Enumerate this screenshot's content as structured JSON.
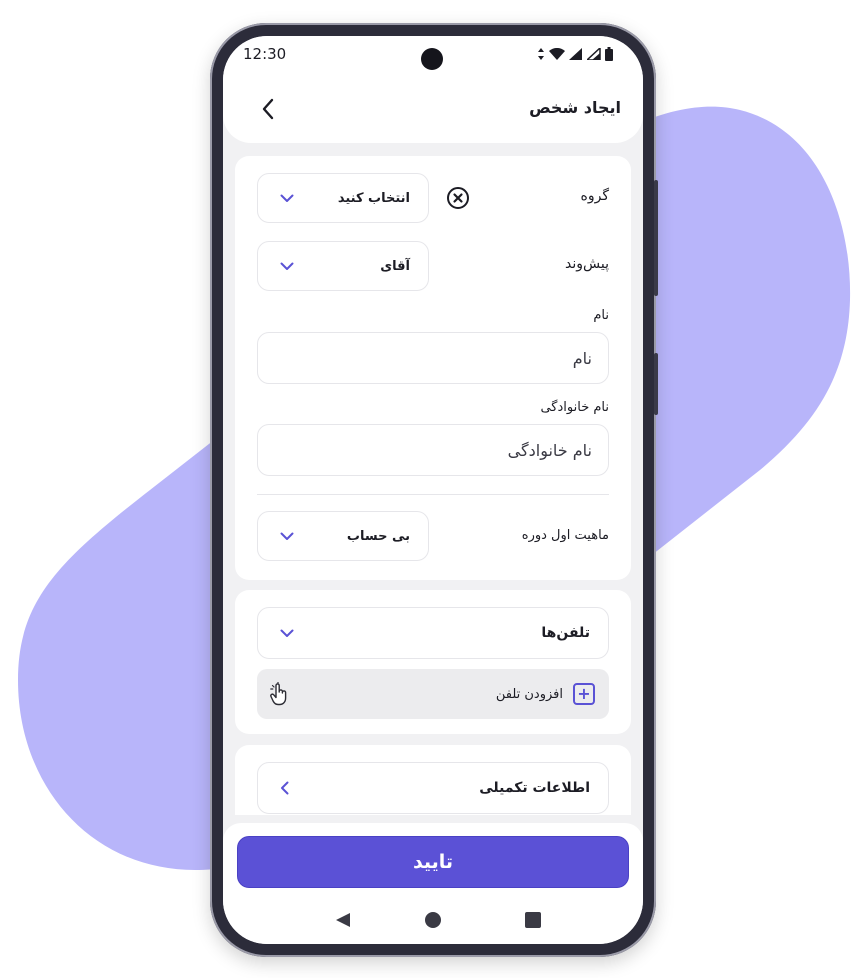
{
  "status_bar": {
    "time": "12:30"
  },
  "header": {
    "title": "ایجاد شخص"
  },
  "form": {
    "group": {
      "label": "گروه",
      "value": "انتخاب کنید"
    },
    "prefix": {
      "label": "پیش‌وند",
      "value": "آقای"
    },
    "first_name": {
      "label": "نام",
      "placeholder": "نام"
    },
    "last_name": {
      "label": "نام خانوادگی",
      "placeholder": "نام خانوادگی"
    },
    "opening_nature": {
      "label": "ماهیت اول دوره",
      "value": "بی حساب"
    }
  },
  "phones": {
    "label": "تلفن‌ها",
    "add_label": "افزودن تلفن"
  },
  "additional": {
    "label": "اطلاعات تکمیلی"
  },
  "footer": {
    "confirm_label": "تایید"
  },
  "colors": {
    "accent": "#5b51d6",
    "blob": "#b8b5fa",
    "chevron": "#5a52d5"
  }
}
